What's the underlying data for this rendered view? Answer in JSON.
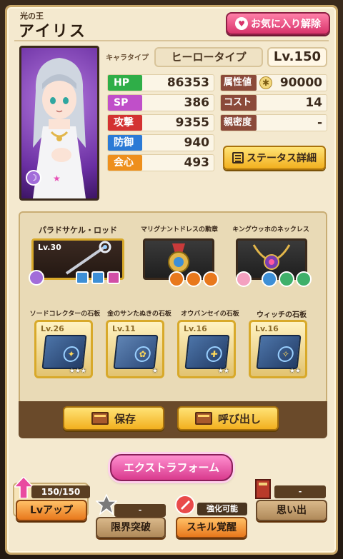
{
  "header": {
    "title_sub": "光の王",
    "title_main": "アイリス",
    "favorite_button": "お気に入り解除"
  },
  "character": {
    "type_label": "キャラタイプ",
    "type_value": "ヒーロータイプ",
    "level": "Lv.150",
    "element_icon": "light-element-icon",
    "stars_icon": "star-icon"
  },
  "stats": {
    "hp": {
      "label": "HP",
      "value": "86353"
    },
    "sp": {
      "label": "SP",
      "value": "386"
    },
    "atk": {
      "label": "攻撃",
      "value": "9355"
    },
    "def": {
      "label": "防御",
      "value": "940"
    },
    "crit": {
      "label": "会心",
      "value": "493"
    },
    "attr": {
      "label": "属性値",
      "value": "90000"
    },
    "cost": {
      "label": "コスト",
      "value": "14"
    },
    "affinity": {
      "label": "親密度",
      "value": "-"
    }
  },
  "status_button": "ステータス詳細",
  "equipment": {
    "weapon": {
      "name": "パラドサケル・ロッド",
      "level": "Lv.30"
    },
    "armor": {
      "name": "マリグナントドレスの勲章"
    },
    "accessory": {
      "name": "キングウッホのネックレス"
    }
  },
  "stones": [
    {
      "name": "ソードコレクターの石板",
      "level": "Lv.26",
      "stars": "★★★"
    },
    {
      "name": "金のサンたぬきの石板",
      "level": "Lv.11",
      "stars": "★"
    },
    {
      "name": "オウバンセイの石板",
      "level": "Lv.16",
      "stars": "★★"
    },
    {
      "name": "ウィッチの石板",
      "level": "Lv.16",
      "stars": "★★"
    }
  ],
  "actions": {
    "save": "保存",
    "load": "呼び出し"
  },
  "bottom": {
    "extra_form": "エクストラフォーム",
    "lv_count": "150/150",
    "lv_up": "Lvアップ",
    "limit_count": "-",
    "limit_break": "限界突破",
    "skill_badge": "強化可能",
    "skill_awaken": "スキル覚醒",
    "memory_count": "-",
    "memory": "思い出"
  },
  "colors": {
    "panel": "#f4e9cf",
    "hp": "#2fae48",
    "sp": "#c04fc9",
    "atk": "#d33232",
    "def": "#2b7ad6",
    "crit": "#ee8f1c",
    "favorite": "#d8336b",
    "gold_button": "#f2b01f"
  }
}
